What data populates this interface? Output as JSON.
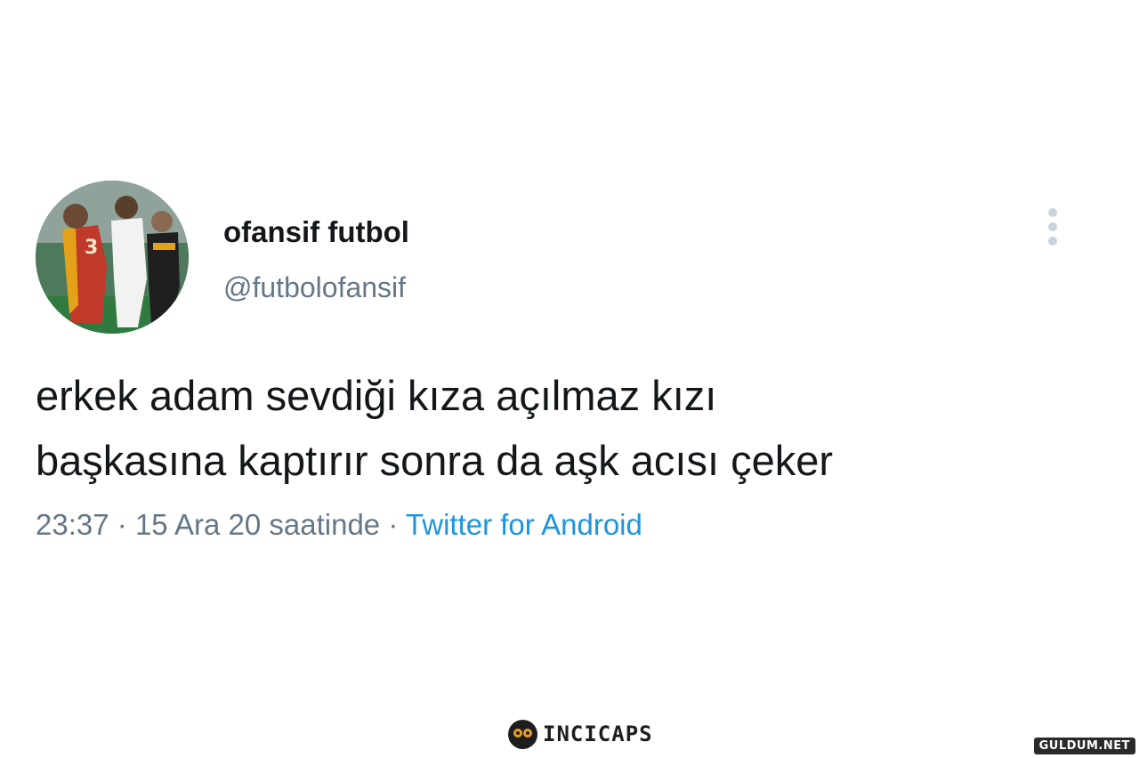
{
  "tweet": {
    "display_name": "ofansif futbol",
    "handle": "@futbolofansif",
    "text_lines": [
      "erkek adam sevdiği kıza açılmaz kızı",
      "başkasına kaptırır sonra da aşk acısı çeker"
    ],
    "time": "23:37",
    "separator": "·",
    "date": "15 Ara 20 saatinde",
    "source": "Twitter for Android",
    "more_icon": "vertical-ellipsis-icon",
    "avatar_icon": "football-players-photo"
  },
  "branding": {
    "logo_text": "INCICAPS",
    "logo_icon": "owl-icon",
    "watermark_text": "GULDUM.NET"
  },
  "colors": {
    "text_primary": "#14171a",
    "text_secondary": "#657786",
    "link": "#1b95e0"
  }
}
